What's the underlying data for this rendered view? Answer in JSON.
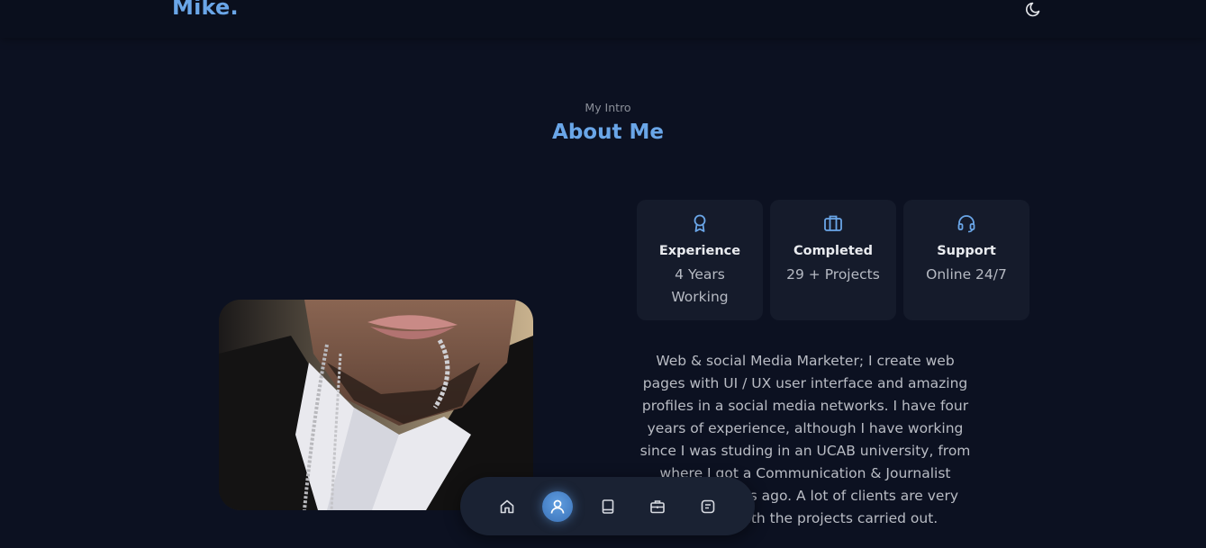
{
  "header": {
    "logo": "Mike.",
    "theme_icon": "moon-icon"
  },
  "section": {
    "subtitle": "My Intro",
    "title": "About Me"
  },
  "photo": {
    "alt": "Portrait photo"
  },
  "cards": [
    {
      "icon": "award-icon",
      "title": "Experience",
      "subtitle": "4 Years Working"
    },
    {
      "icon": "briefcase-icon",
      "title": "Completed",
      "subtitle": "29 + Projects"
    },
    {
      "icon": "headset-icon",
      "title": "Support",
      "subtitle": "Online 24/7"
    }
  ],
  "description": "Web & social Media Marketer; I create web pages with UI / UX user interface and amazing profiles in a social media networks. I have four years of experience, although I have working since I was studing in an UCAB university, from where I got a Communication & Journalist degree 3 years ago. A lot of clients are very satisfied with the projects carried out.",
  "nav": {
    "items": [
      {
        "icon": "home-icon",
        "active": false
      },
      {
        "icon": "user-icon",
        "active": true
      },
      {
        "icon": "book-icon",
        "active": false
      },
      {
        "icon": "briefcase-icon",
        "active": false
      },
      {
        "icon": "message-icon",
        "active": false
      }
    ]
  },
  "colors": {
    "accent": "#6aa6e8",
    "background": "#0c1121",
    "card": "#151b2b"
  }
}
